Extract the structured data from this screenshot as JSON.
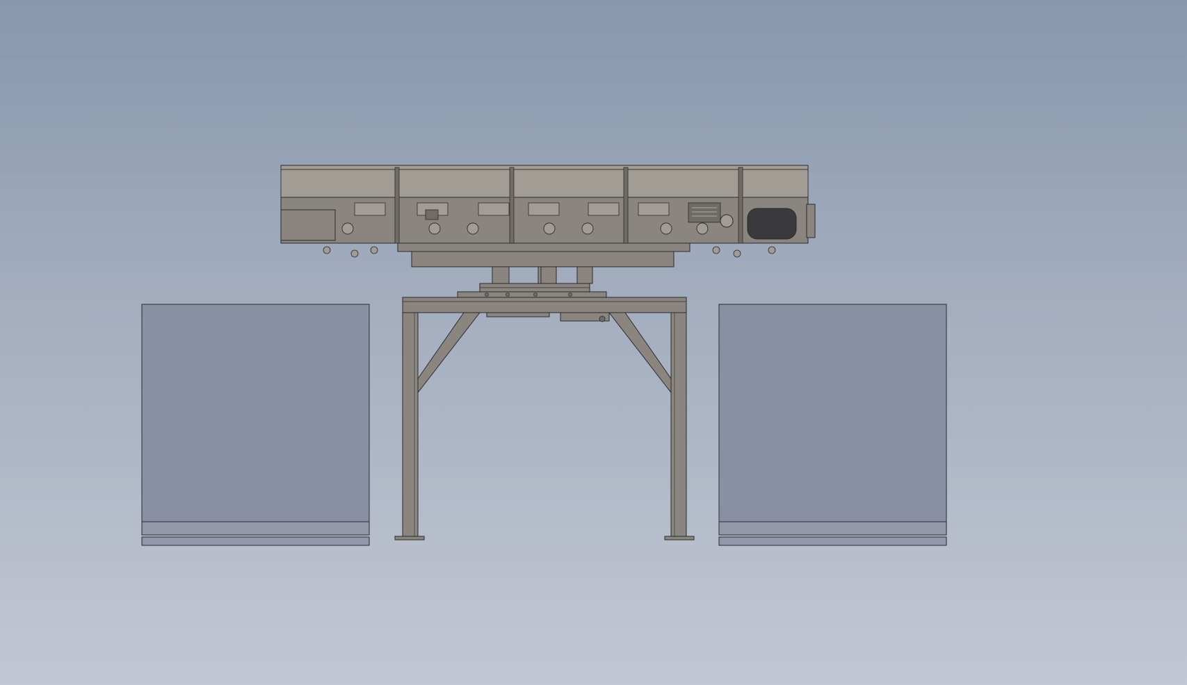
{
  "viewport": {
    "background_top": "#8797ad",
    "background_bottom": "#c2c7d3"
  },
  "model": {
    "components": [
      {
        "id": "left-bin",
        "kind": "storage bin"
      },
      {
        "id": "vibratory-conveyor",
        "kind": "conveyor pan",
        "section_count": 5
      },
      {
        "id": "drive-base",
        "kind": "mount base"
      },
      {
        "id": "support-stand",
        "kind": "frame stand"
      },
      {
        "id": "right-bin",
        "kind": "storage bin"
      }
    ],
    "colors": {
      "steel": "#8a857e",
      "steel_dark": "#6f6b65",
      "steel_light": "#a19c94",
      "bin_face": "#8a90a4",
      "bin_band": "#9297aa",
      "outline": "#2b2b2f",
      "roller": "#3a3a3c"
    }
  }
}
